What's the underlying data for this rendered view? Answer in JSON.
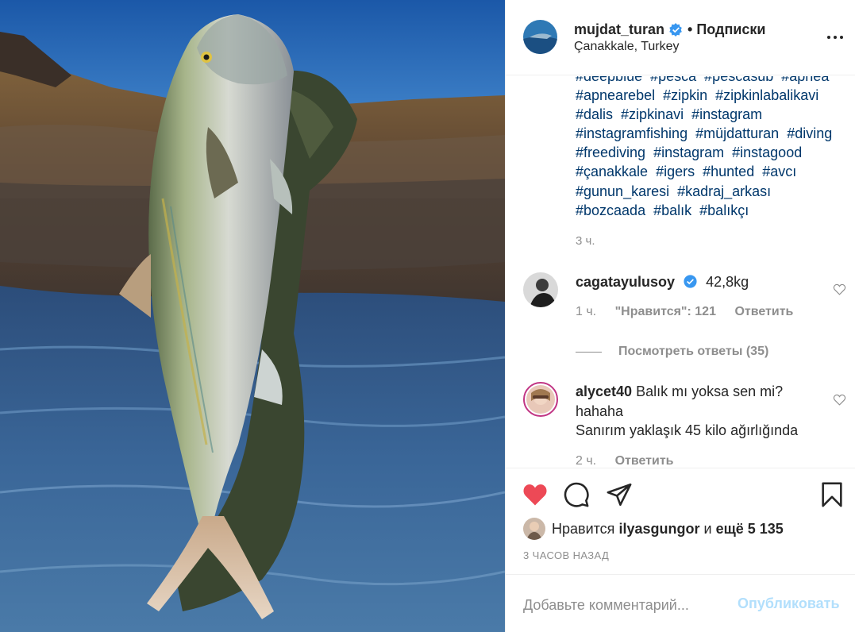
{
  "header": {
    "username": "mujdat_turan",
    "separator": "•",
    "follow_status": "Подписки",
    "location": "Çanakkale, Turkey"
  },
  "caption": {
    "hashtags": [
      "#deepblue",
      "#pesca",
      "#pescasub",
      "#apnea",
      "#apnearebel",
      "#zipkin",
      "#zipkinlabalikavi",
      "#dalis",
      "#zipkinavi",
      "#instagram",
      "#instagramfishing",
      "#müjdatturan",
      "#diving",
      "#freediving",
      "#instagram",
      "#instagood",
      "#çanakkale",
      "#igers",
      "#hunted",
      "#avcı",
      "#gunun_karesi",
      "#kadraj_arkası",
      "#bozcaada",
      "#balık",
      "#balıkçı"
    ],
    "time": "3 ч."
  },
  "comments": [
    {
      "username": "cagatayulusoy",
      "verified": true,
      "text": "42,8kg",
      "time": "1 ч.",
      "likes": "\"Нравится\": 121",
      "reply": "Ответить",
      "view_replies": "Посмотреть ответы (35)"
    },
    {
      "username": "alycet40",
      "text": "Balık mı yoksa sen mi? hahaha",
      "text2": "Sanırım yaklaşık 45 kilo ağırlığında",
      "time": "2 ч.",
      "reply": "Ответить"
    }
  ],
  "likes": {
    "prefix": "Нравится",
    "user": "ilyasgungor",
    "middle": "и",
    "count": "ещё 5 135"
  },
  "posted_ago": "3 ЧАСОВ НАЗАД",
  "add_comment": {
    "placeholder": "Добавьте комментарий...",
    "post_label": "Опубликовать"
  },
  "icons": {
    "like": "heart-filled-icon",
    "comment": "comment-icon",
    "share": "share-icon",
    "save": "bookmark-icon",
    "more": "more-options-icon",
    "verified": "verified-badge-icon"
  },
  "colors": {
    "heart_red": "#ed4956",
    "hashtag_blue": "#00376b",
    "verified_blue": "#3897f0",
    "post_button_disabled": "#b2dffc"
  }
}
